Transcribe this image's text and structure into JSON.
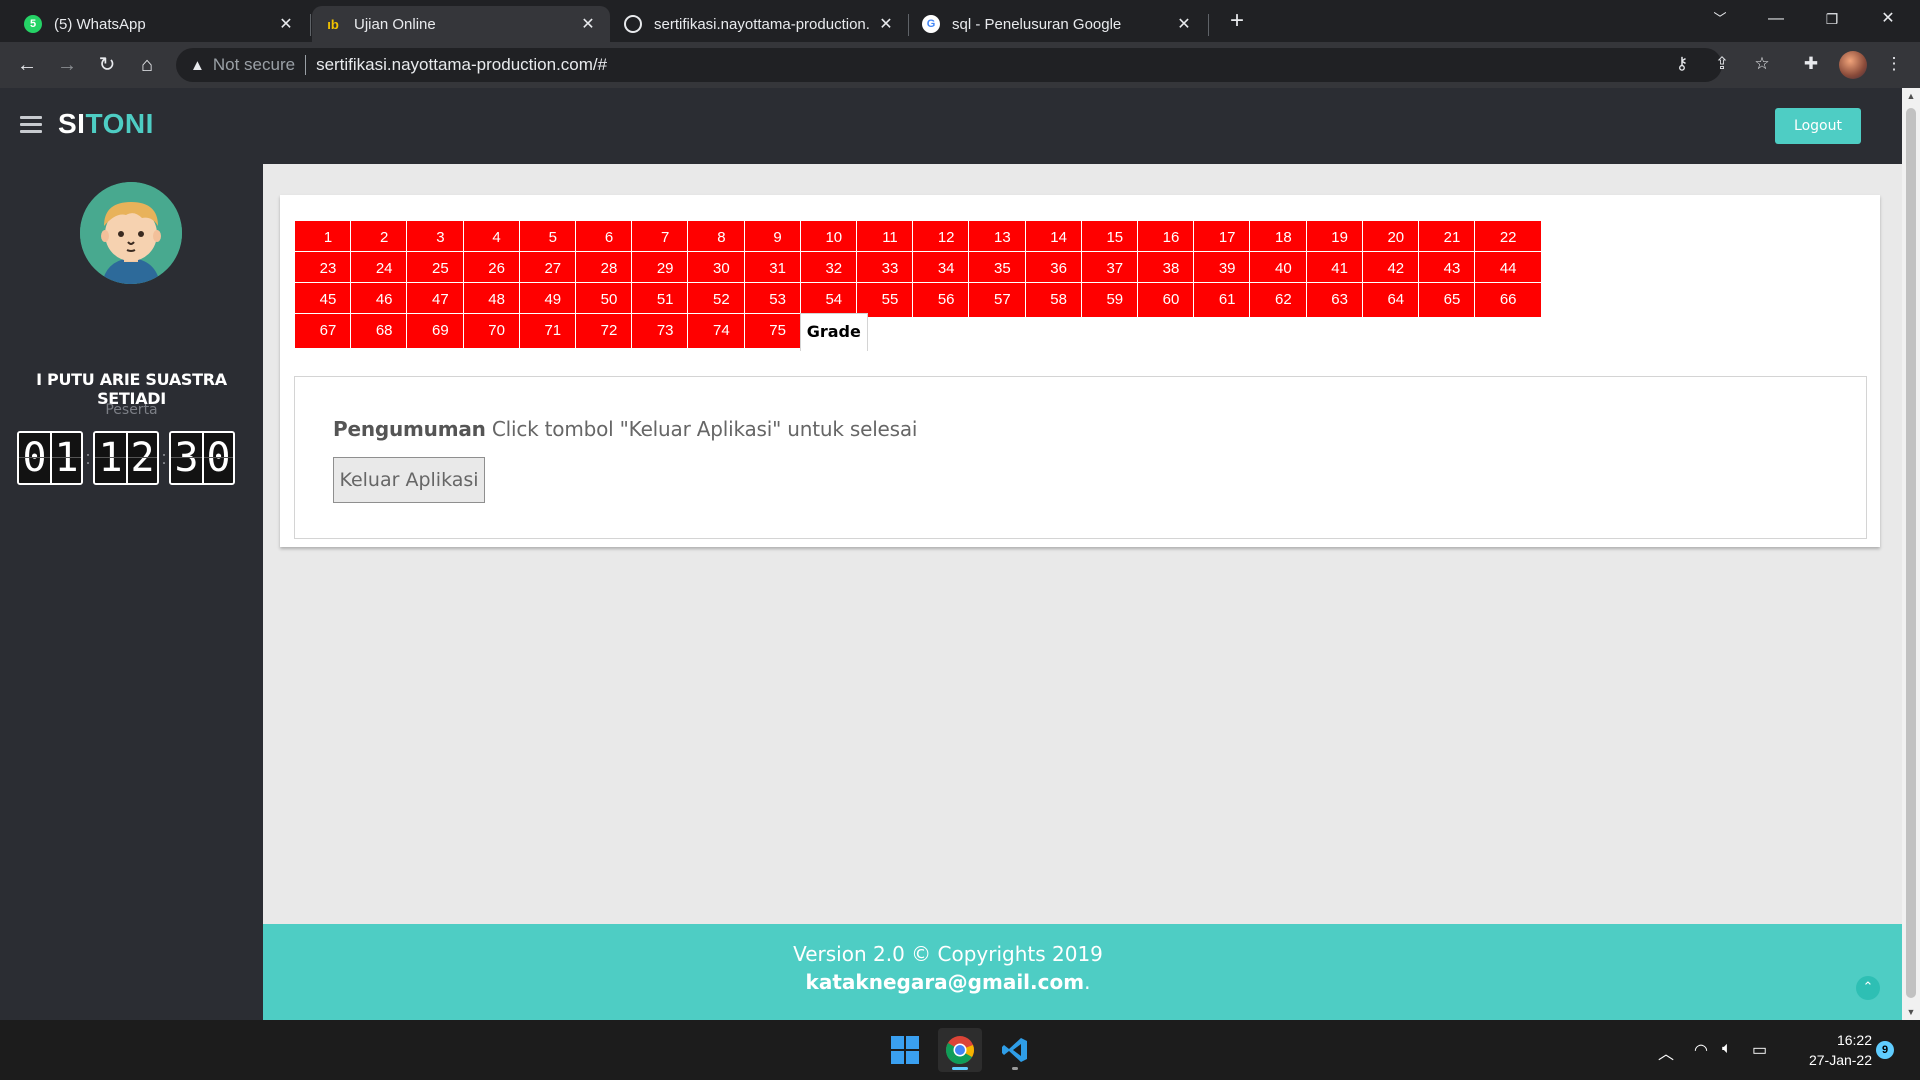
{
  "browser": {
    "tabs": [
      {
        "title": "(5) WhatsApp",
        "favicon": "whatsapp-icon",
        "favicon_color": "#25d366",
        "badge": "5"
      },
      {
        "title": "Ujian Online",
        "favicon": "ujian-icon",
        "favicon_color": "#f2c200"
      },
      {
        "title": "sertifikasi.nayottama-production.",
        "favicon": "globe-icon",
        "favicon_color": "#9aa0a6"
      },
      {
        "title": "sql - Penelusuran Google",
        "favicon": "google-icon",
        "favicon_color": "#ffffff"
      }
    ],
    "security_label": "Not secure",
    "url": "sertifikasi.nayottama-production.com/#"
  },
  "app": {
    "logo_part1": "SI",
    "logo_part2": "TONI",
    "logout_label": "Logout",
    "accent_color": "#4ecdc4"
  },
  "user": {
    "name": "I PUTU ARIE SUASTRA SETIADI",
    "role": "Peserta",
    "timer": {
      "hours": "01",
      "minutes": "12",
      "seconds": "30"
    }
  },
  "questions": {
    "numbers": [
      "1",
      "2",
      "3",
      "4",
      "5",
      "6",
      "7",
      "8",
      "9",
      "10",
      "11",
      "12",
      "13",
      "14",
      "15",
      "16",
      "17",
      "18",
      "19",
      "20",
      "21",
      "22",
      "23",
      "24",
      "25",
      "26",
      "27",
      "28",
      "29",
      "30",
      "31",
      "32",
      "33",
      "34",
      "35",
      "36",
      "37",
      "38",
      "39",
      "40",
      "41",
      "42",
      "43",
      "44",
      "45",
      "46",
      "47",
      "48",
      "49",
      "50",
      "51",
      "52",
      "53",
      "54",
      "55",
      "56",
      "57",
      "58",
      "59",
      "60",
      "61",
      "62",
      "63",
      "64",
      "65",
      "66",
      "67",
      "68",
      "69",
      "70",
      "71",
      "72",
      "73",
      "74",
      "75"
    ],
    "button_color": "#ff0000",
    "grade_label": "Grade"
  },
  "announcement": {
    "title": "Pengumuman",
    "text": "Click tombol \"Keluar Aplikasi\" untuk selesai",
    "exit_label": "Keluar Aplikasi"
  },
  "footer": {
    "version": "Version 2.0 © Copyrights 2019",
    "email": "kataknegara@gmail.com",
    "email_suffix": "."
  },
  "taskbar": {
    "time": "16:22",
    "date": "27-Jan-22",
    "notification_count": "9"
  }
}
